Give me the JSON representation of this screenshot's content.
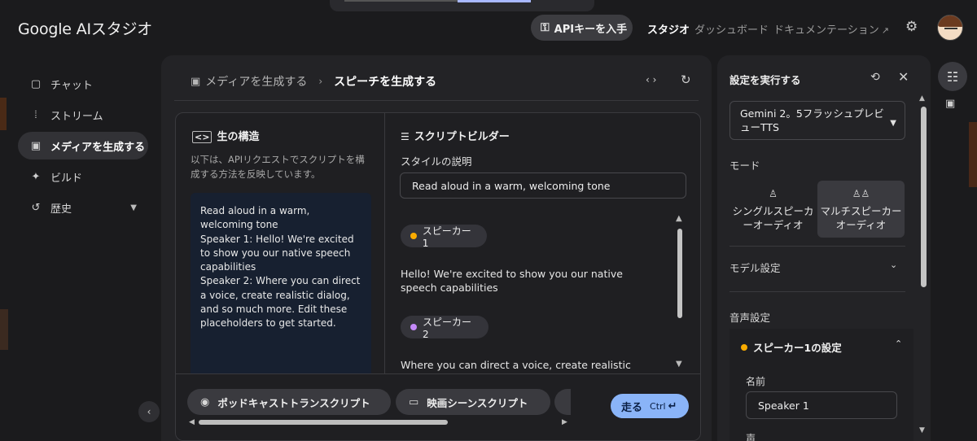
{
  "header": {
    "logo": "Google AIスタジオ",
    "api_key_button": "APIキーを入手",
    "nav": {
      "studio": "スタジオ",
      "dashboard": "ダッシュボード",
      "docs": "ドキュメンテーション"
    }
  },
  "sidebar": {
    "items": [
      {
        "label": "チャット",
        "icon": "chat-icon"
      },
      {
        "label": "ストリーム",
        "icon": "stream-icon"
      },
      {
        "label": "メディアを生成する",
        "icon": "image-icon",
        "active": true
      },
      {
        "label": "ビルド",
        "icon": "build-icon"
      },
      {
        "label": "歴史",
        "icon": "history-icon"
      }
    ]
  },
  "main": {
    "breadcrumb": {
      "parent": "メディアを生成する",
      "current": "スピーチを生成する"
    },
    "raw": {
      "title": "生の構造",
      "description": "以下は、APIリクエストでスクリプトを構成する方法を反映しています。",
      "content": "Read aloud in a warm, welcoming tone\nSpeaker 1: Hello! We're excited to show you our native speech capabilities\nSpeaker 2: Where you can direct a voice, create realistic dialog, and so much more. Edit these placeholders to get started."
    },
    "builder": {
      "title": "スクリプトビルダー",
      "style_label": "スタイルの説明",
      "style_value": "Read aloud in a warm, welcoming tone",
      "speakers": [
        {
          "label": "スピーカー1",
          "color": "#f9ab00",
          "text": "Hello! We're excited to show you our native speech capabilities"
        },
        {
          "label": "スピーカー2",
          "color": "#c58af9",
          "text": "Where you can direct a voice, create realistic dialog, and"
        }
      ]
    },
    "presets": [
      {
        "label": "ポッドキャストトランスクリプト",
        "icon": "podcast-icon"
      },
      {
        "label": "映画シーンスクリプト",
        "icon": "movie-icon"
      }
    ],
    "run": {
      "label": "走る",
      "shortcut": "Ctrl"
    }
  },
  "settings": {
    "title": "設定を実行する",
    "model": "Gemini 2。5フラッシュプレビューTTS",
    "mode_label": "モード",
    "modes": {
      "single": "シングルスピーカーオーディオ",
      "multi": "マルチスピーカーオーディオ"
    },
    "model_settings": "モデル設定",
    "voice_settings": "音声設定",
    "speaker_settings": {
      "title": "スピーカー1の設定",
      "color": "#f9ab00",
      "name_label": "名前",
      "name_value": "Speaker 1",
      "voice_label": "声"
    }
  },
  "colors": {
    "accent": "#8ab4f8",
    "background": "#1b1b1d"
  }
}
